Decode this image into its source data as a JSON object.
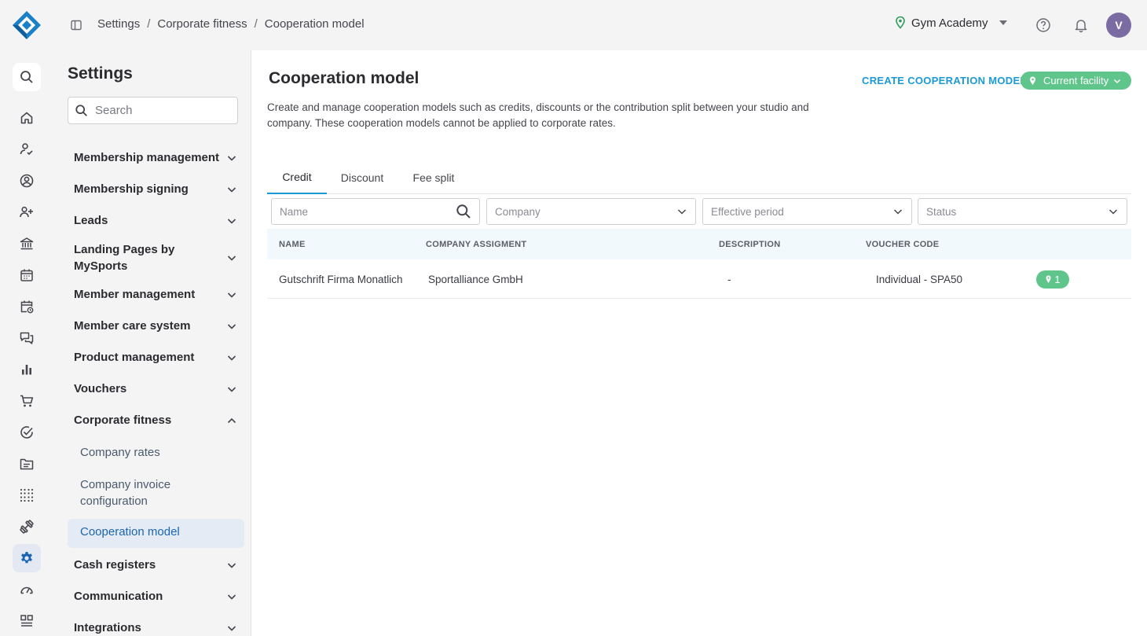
{
  "colors": {
    "accent": "#1a9ad6",
    "success": "#5fc58a",
    "active_nav_bg": "#e5ebf5",
    "active_nav_text": "#1a66b0",
    "avatar": "#7b6ba3",
    "table_header_bg": "#f1f9fc"
  },
  "topbar": {
    "breadcrumb": [
      "Settings",
      "Corporate fitness",
      "Cooperation model"
    ],
    "facility_name": "Gym Academy",
    "user_initial": "V",
    "icons": [
      "logo-icon",
      "sidebar-toggle-icon",
      "location-pin-icon",
      "help-icon",
      "bell-icon"
    ]
  },
  "rail": {
    "items": [
      "search-icon",
      "home-icon",
      "user-check-icon",
      "user-circle-icon",
      "user-plus-icon",
      "bank-icon",
      "calendar-icon",
      "calendar-clock-icon",
      "chat-icon",
      "bar-chart-icon",
      "cart-icon",
      "check-circle-icon",
      "folder-icon",
      "dots-grid-icon",
      "dumbbell-icon",
      "gear-icon",
      "gauge-icon",
      "apps-icon"
    ]
  },
  "settings": {
    "title": "Settings",
    "search_placeholder": "Search",
    "groups": {
      "membership_management": "Membership management",
      "membership_signing": "Membership signing",
      "leads": "Leads",
      "landing_pages": "Landing Pages by MySports",
      "member_management": "Member management",
      "member_care": "Member care system",
      "product_management": "Product management",
      "vouchers": "Vouchers",
      "corporate_fitness": "Corporate fitness",
      "cash_registers": "Cash registers",
      "communication": "Communication",
      "integrations": "Integrations"
    },
    "corporate_sub": {
      "company_rates": "Company rates",
      "invoice_config": "Company invoice configuration",
      "cooperation_model": "Cooperation model"
    }
  },
  "main": {
    "title": "Cooperation model",
    "create_button": "CREATE COOPERATION MODEL",
    "facility_filter": "Current facility",
    "description": "Create and manage cooperation models such as credits, discounts or the contribution split between your studio and company. These cooperation models cannot be applied to corporate rates.",
    "tabs": [
      "Credit",
      "Discount",
      "Fee split"
    ],
    "active_tab": "Credit",
    "filters": {
      "name_placeholder": "Name",
      "company": "Company",
      "effective_period": "Effective period",
      "status": "Status"
    },
    "table": {
      "columns": [
        "NAME",
        "COMPANY ASSIGMENT",
        "DESCRIPTION",
        "VOUCHER CODE"
      ],
      "rows": [
        {
          "name": "Gutschrift Firma Monatlich",
          "company": "Sportalliance GmbH",
          "description": "-",
          "voucher_code": "Individual - SPA50",
          "facility_count": "1"
        }
      ]
    }
  }
}
